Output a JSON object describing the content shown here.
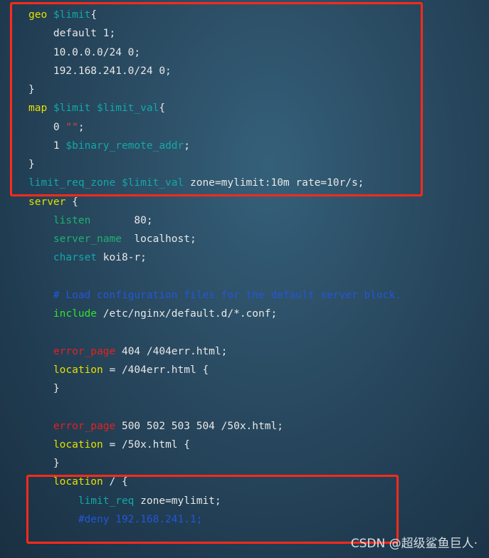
{
  "colors": {
    "keyword": "#e4e000",
    "variable": "#12a8a8",
    "directive": "#1fb070",
    "include": "#33e033",
    "error_page": "#e82020",
    "comment": "#2456d8",
    "text": "#e8e8e8",
    "highlight_box": "#ff2a1a"
  },
  "code_lines": [
    [
      [
        "geo ",
        "kw"
      ],
      [
        "$limit",
        "var"
      ],
      [
        "{",
        "txt"
      ]
    ],
    [
      [
        "    default 1;",
        "txt"
      ]
    ],
    [
      [
        "    10.0.0.0/24 0;",
        "txt"
      ]
    ],
    [
      [
        "    192.168.241.0/24 0;",
        "txt"
      ]
    ],
    [
      [
        "}",
        "txt"
      ]
    ],
    [
      [
        "map ",
        "kw"
      ],
      [
        "$limit $limit_val",
        "var"
      ],
      [
        "{",
        "txt"
      ]
    ],
    [
      [
        "    0 ",
        "txt"
      ],
      [
        "\"\"",
        "str"
      ],
      [
        ";",
        "txt"
      ]
    ],
    [
      [
        "    1 ",
        "txt"
      ],
      [
        "$binary_remote_addr",
        "var"
      ],
      [
        ";",
        "txt"
      ]
    ],
    [
      [
        "}",
        "txt"
      ]
    ],
    [
      [
        "limit_req_zone $limit_val",
        "var"
      ],
      [
        " zone=mylimit:10m rate=10r/s;",
        "txt"
      ]
    ],
    [
      [
        "server",
        "kw"
      ],
      [
        " {",
        "txt"
      ]
    ],
    [
      [
        "    ",
        "txt"
      ],
      [
        "listen",
        "dir"
      ],
      [
        "       80;",
        "txt"
      ]
    ],
    [
      [
        "    ",
        "txt"
      ],
      [
        "server_name",
        "dir"
      ],
      [
        "  localhost;",
        "txt"
      ]
    ],
    [
      [
        "    ",
        "txt"
      ],
      [
        "charset",
        "var"
      ],
      [
        " koi8-r;",
        "txt"
      ]
    ],
    [],
    [
      [
        "    ",
        "txt"
      ],
      [
        "# Load configuration files for the default server block.",
        "com"
      ]
    ],
    [
      [
        "    ",
        "txt"
      ],
      [
        "include",
        "inc"
      ],
      [
        " /etc/nginx/default.d/*.conf;",
        "txt"
      ]
    ],
    [],
    [
      [
        "    ",
        "txt"
      ],
      [
        "error_page",
        "err"
      ],
      [
        " 404 /404err.html;",
        "txt"
      ]
    ],
    [
      [
        "    ",
        "txt"
      ],
      [
        "location",
        "kw"
      ],
      [
        " = /404err.html {",
        "txt"
      ]
    ],
    [
      [
        "    }",
        "txt"
      ]
    ],
    [],
    [
      [
        "    ",
        "txt"
      ],
      [
        "error_page",
        "err"
      ],
      [
        " 500 502 503 504 /50x.html;",
        "txt"
      ]
    ],
    [
      [
        "    ",
        "txt"
      ],
      [
        "location",
        "kw"
      ],
      [
        " = /50x.html {",
        "txt"
      ]
    ],
    [
      [
        "    }",
        "txt"
      ]
    ],
    [
      [
        "    ",
        "txt"
      ],
      [
        "location",
        "kw"
      ],
      [
        " / {",
        "txt"
      ]
    ],
    [
      [
        "        ",
        "txt"
      ],
      [
        "limit_req",
        "var"
      ],
      [
        " zone=mylimit;",
        "txt"
      ]
    ],
    [
      [
        "        ",
        "txt"
      ],
      [
        "#deny 192.168.241.1;",
        "com"
      ]
    ]
  ],
  "watermark": "CSDN @超级鲨鱼巨人·"
}
